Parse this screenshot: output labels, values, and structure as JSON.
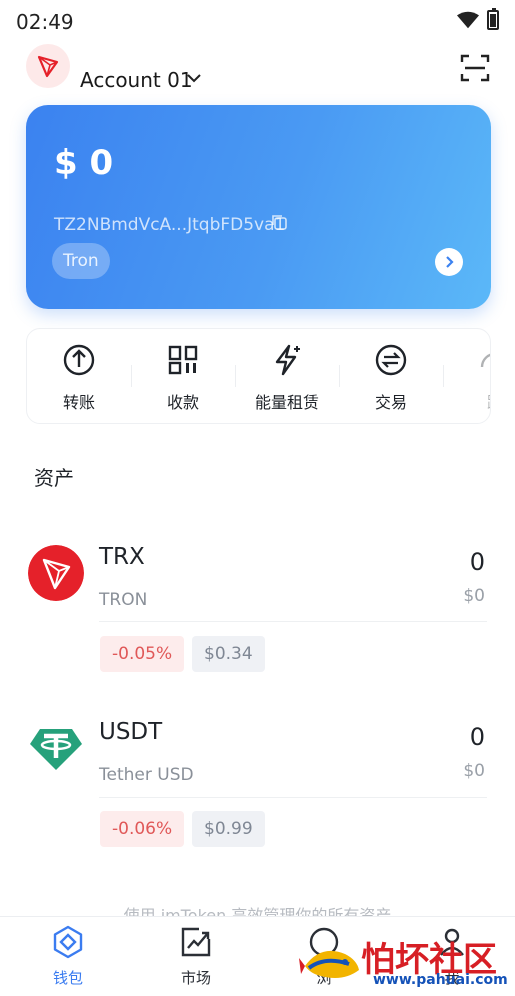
{
  "status": {
    "time": "02:49"
  },
  "account": {
    "name": "Account 01"
  },
  "card": {
    "balance": "$ 0",
    "address": "TZ2NBmdVcA...JtqbFD5va1",
    "chain": "Tron"
  },
  "actions": [
    {
      "label": "转账",
      "icon": "transfer-icon"
    },
    {
      "label": "收款",
      "icon": "qr-code-icon"
    },
    {
      "label": "能量租赁",
      "icon": "energy-icon"
    },
    {
      "label": "交易",
      "icon": "swap-icon"
    },
    {
      "label": "跨",
      "icon": "bridge-icon"
    }
  ],
  "assets_title": "资产",
  "assets": [
    {
      "symbol": "TRX",
      "name": "TRON",
      "amount": "0",
      "value": "$0",
      "change": "-0.05%",
      "price": "$0.34",
      "icon": "tron-logo"
    },
    {
      "symbol": "USDT",
      "name": "Tether USD",
      "amount": "0",
      "value": "$0",
      "change": "-0.06%",
      "price": "$0.99",
      "icon": "tether-logo"
    }
  ],
  "hint": "使用 imToken 高效管理你的所有资产",
  "tabs": [
    {
      "label": "钱包",
      "active": true,
      "icon": "wallet-icon"
    },
    {
      "label": "市场",
      "active": false,
      "icon": "market-icon"
    },
    {
      "label": "浏",
      "active": false,
      "icon": "browser-icon"
    },
    {
      "label": "我",
      "active": false,
      "icon": "profile-icon"
    }
  ],
  "watermark": {
    "text": "怕坏社区",
    "url": "www.pahuai.com"
  },
  "colors": {
    "accent": "#3b7cf0",
    "card_start": "#3b82f0",
    "card_end": "#5bb8f8",
    "trx_red": "#e5212a",
    "usdt_green": "#26a17b",
    "negative": "#e05858"
  }
}
